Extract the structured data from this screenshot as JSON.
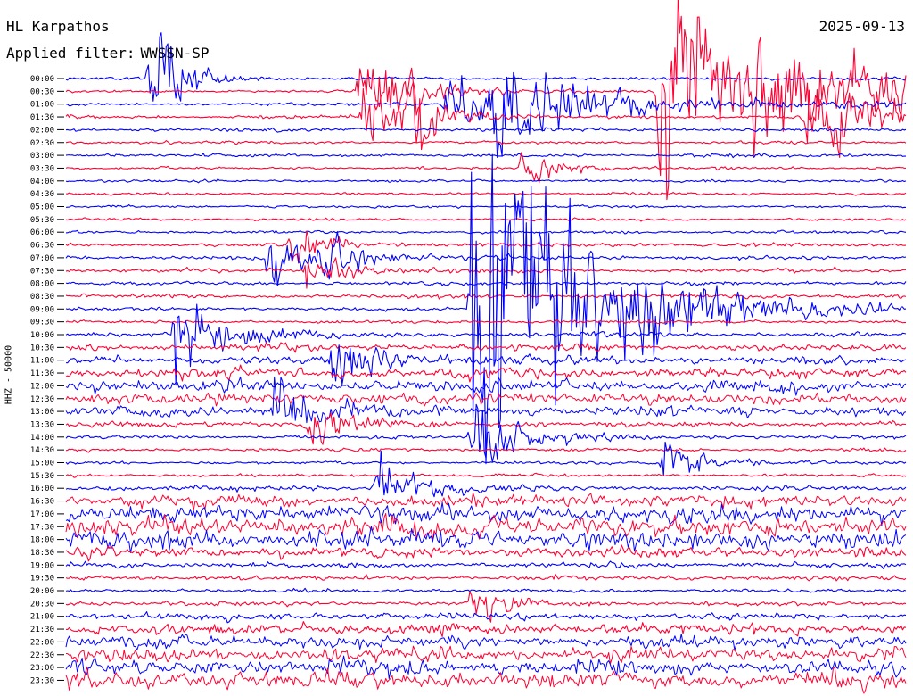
{
  "header": {
    "station": "HL Karpathos",
    "date": "2025-09-13",
    "filter_label": "Applied filter:",
    "filter_value": "WWSSN-SP",
    "channel": "HHZ - 50000"
  },
  "colors": {
    "odd_trace": "#0000ff",
    "even_trace": "#ff0033",
    "text": "#000000",
    "background": "#ffffff"
  },
  "chart_data": {
    "type": "line",
    "title": "HL Karpathos",
    "subtitle": "Applied filter: WWSSN-SP",
    "xlabel": "",
    "ylabel": "HHZ - 50000",
    "date": "2025-09-13",
    "grid": false,
    "legend": "none",
    "rows": [
      "00:00",
      "00:30",
      "01:00",
      "01:30",
      "02:00",
      "02:30",
      "03:00",
      "03:30",
      "04:00",
      "04:30",
      "05:00",
      "05:30",
      "06:00",
      "06:30",
      "07:00",
      "07:30",
      "08:00",
      "08:30",
      "09:00",
      "09:30",
      "10:00",
      "10:30",
      "11:00",
      "11:30",
      "12:00",
      "12:30",
      "13:00",
      "13:30",
      "14:00",
      "14:30",
      "15:00",
      "15:30",
      "16:00",
      "16:30",
      "17:00",
      "17:30",
      "18:00",
      "18:30",
      "19:00",
      "19:30",
      "20:00",
      "20:30",
      "21:00",
      "21:30",
      "22:00",
      "22:30",
      "23:00",
      "23:30"
    ],
    "row_colors": [
      "blue",
      "red"
    ],
    "noise_by_row": [
      0.9,
      0.8,
      0.9,
      1.0,
      1.0,
      0.8,
      0.9,
      0.7,
      0.8,
      0.7,
      0.7,
      0.7,
      0.8,
      1.0,
      1.1,
      1.1,
      1.1,
      1.1,
      1.0,
      0.9,
      1.2,
      1.9,
      2.3,
      3.0,
      3.5,
      3.2,
      3.1,
      1.5,
      1.0,
      0.9,
      0.8,
      0.9,
      1.4,
      3.6,
      5.2,
      5.5,
      5.5,
      3.0,
      1.5,
      1.2,
      1.0,
      1.2,
      2.0,
      3.0,
      3.6,
      4.0,
      4.4,
      4.8
    ],
    "events": [
      {
        "row": 0,
        "minute": 3,
        "amp": 55,
        "decay": 1.0
      },
      {
        "row": 1,
        "minute": 10.5,
        "amp": 48,
        "decay": 1.5
      },
      {
        "row": 2,
        "minute": 13.5,
        "amp": 18,
        "decay": 6.0
      },
      {
        "row": 2,
        "minute": 15.2,
        "amp": 40,
        "decay": 1.8
      },
      {
        "row": 3,
        "minute": 10.6,
        "amp": 42,
        "decay": 1.0
      },
      {
        "row": 3,
        "minute": 12.2,
        "amp": 35,
        "decay": 1.0
      },
      {
        "row": 1,
        "minute": 21.2,
        "amp": 65,
        "decay": 7.0
      },
      {
        "row": 3,
        "minute": 26.4,
        "amp": 30,
        "decay": 3.0
      },
      {
        "row": 7,
        "minute": 16.2,
        "amp": 18,
        "decay": 1.2
      },
      {
        "row": 13,
        "minute": 8.0,
        "amp": 20,
        "decay": 1.0
      },
      {
        "row": 14,
        "minute": 7.2,
        "amp": 24,
        "decay": 1.5
      },
      {
        "row": 14,
        "minute": 9.3,
        "amp": 18,
        "decay": 1.3
      },
      {
        "row": 15,
        "minute": 8.6,
        "amp": 16,
        "decay": 1.2
      },
      {
        "row": 18,
        "minute": 14.5,
        "amp": 190,
        "decay": 3.5
      },
      {
        "row": 20,
        "minute": 3.9,
        "amp": 38,
        "decay": 1.6
      },
      {
        "row": 22,
        "minute": 9.5,
        "amp": 30,
        "decay": 1.0
      },
      {
        "row": 26,
        "minute": 7.4,
        "amp": 26,
        "decay": 1.2
      },
      {
        "row": 27,
        "minute": 8.6,
        "amp": 22,
        "decay": 1.2
      },
      {
        "row": 28,
        "minute": 14.5,
        "amp": 30,
        "decay": 1.6
      },
      {
        "row": 30,
        "minute": 21.3,
        "amp": 20,
        "decay": 1.1
      },
      {
        "row": 32,
        "minute": 11.1,
        "amp": 26,
        "decay": 1.4
      },
      {
        "row": 41,
        "minute": 14.5,
        "amp": 20,
        "decay": 1.0
      }
    ]
  }
}
